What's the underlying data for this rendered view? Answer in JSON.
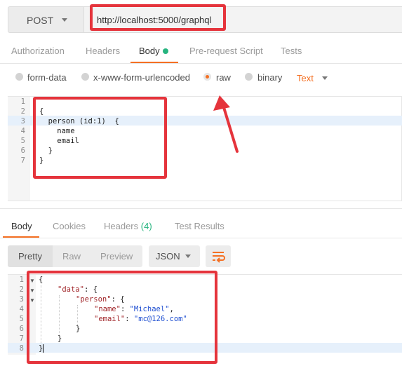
{
  "request": {
    "method": "POST",
    "url": "http://localhost:5000/graphql"
  },
  "request_tabs": [
    "Authorization",
    "Headers",
    "Body",
    "Pre-request Script",
    "Tests"
  ],
  "body_types": {
    "options": [
      "form-data",
      "x-www-form-urlencoded",
      "raw",
      "binary"
    ],
    "selected": "raw",
    "content_type": "Text"
  },
  "request_body": {
    "line_numbers": [
      "1",
      "2",
      "3",
      "4",
      "5",
      "6",
      "7"
    ],
    "lines": [
      "",
      "{",
      "  person (id:1)  {",
      "    name",
      "    email",
      "  }",
      "}"
    ]
  },
  "response_tabs": {
    "body": "Body",
    "cookies": "Cookies",
    "headers": "Headers",
    "headers_count": "(4)",
    "tests": "Test Results"
  },
  "response_view": {
    "modes": [
      "Pretty",
      "Raw",
      "Preview"
    ],
    "format": "JSON"
  },
  "response_body": {
    "line_numbers": [
      "1",
      "2",
      "3",
      "4",
      "5",
      "6",
      "7",
      "8"
    ],
    "open_brace": "{",
    "data_key": "\"data\"",
    "person_key": "\"person\"",
    "name_key": "\"name\"",
    "name_value": "\"Michael\"",
    "email_key": "\"email\"",
    "email_value": "\"mc@126.com\"",
    "colon_brace": ": {",
    "colon": ": ",
    "comma": ",",
    "close_brace": "}"
  },
  "colors": {
    "accent": "#f47023",
    "annotation": "#e5343c",
    "success": "#26b47f"
  },
  "icons": {
    "method_caret": "chevron-down-icon",
    "wrap": "wrap-lines-icon",
    "annotation_arrow": "arrow-icon"
  }
}
